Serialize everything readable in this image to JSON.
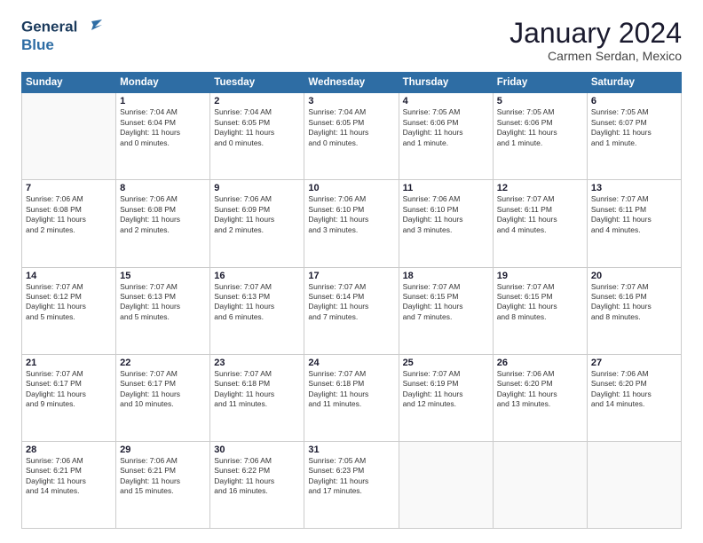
{
  "logo": {
    "line1": "General",
    "line2": "Blue"
  },
  "header": {
    "title": "January 2024",
    "subtitle": "Carmen Serdan, Mexico"
  },
  "days_of_week": [
    "Sunday",
    "Monday",
    "Tuesday",
    "Wednesday",
    "Thursday",
    "Friday",
    "Saturday"
  ],
  "weeks": [
    [
      {
        "day": "",
        "info": ""
      },
      {
        "day": "1",
        "info": "Sunrise: 7:04 AM\nSunset: 6:04 PM\nDaylight: 11 hours\nand 0 minutes."
      },
      {
        "day": "2",
        "info": "Sunrise: 7:04 AM\nSunset: 6:05 PM\nDaylight: 11 hours\nand 0 minutes."
      },
      {
        "day": "3",
        "info": "Sunrise: 7:04 AM\nSunset: 6:05 PM\nDaylight: 11 hours\nand 0 minutes."
      },
      {
        "day": "4",
        "info": "Sunrise: 7:05 AM\nSunset: 6:06 PM\nDaylight: 11 hours\nand 1 minute."
      },
      {
        "day": "5",
        "info": "Sunrise: 7:05 AM\nSunset: 6:06 PM\nDaylight: 11 hours\nand 1 minute."
      },
      {
        "day": "6",
        "info": "Sunrise: 7:05 AM\nSunset: 6:07 PM\nDaylight: 11 hours\nand 1 minute."
      }
    ],
    [
      {
        "day": "7",
        "info": "Sunrise: 7:06 AM\nSunset: 6:08 PM\nDaylight: 11 hours\nand 2 minutes."
      },
      {
        "day": "8",
        "info": "Sunrise: 7:06 AM\nSunset: 6:08 PM\nDaylight: 11 hours\nand 2 minutes."
      },
      {
        "day": "9",
        "info": "Sunrise: 7:06 AM\nSunset: 6:09 PM\nDaylight: 11 hours\nand 2 minutes."
      },
      {
        "day": "10",
        "info": "Sunrise: 7:06 AM\nSunset: 6:10 PM\nDaylight: 11 hours\nand 3 minutes."
      },
      {
        "day": "11",
        "info": "Sunrise: 7:06 AM\nSunset: 6:10 PM\nDaylight: 11 hours\nand 3 minutes."
      },
      {
        "day": "12",
        "info": "Sunrise: 7:07 AM\nSunset: 6:11 PM\nDaylight: 11 hours\nand 4 minutes."
      },
      {
        "day": "13",
        "info": "Sunrise: 7:07 AM\nSunset: 6:11 PM\nDaylight: 11 hours\nand 4 minutes."
      }
    ],
    [
      {
        "day": "14",
        "info": "Sunrise: 7:07 AM\nSunset: 6:12 PM\nDaylight: 11 hours\nand 5 minutes."
      },
      {
        "day": "15",
        "info": "Sunrise: 7:07 AM\nSunset: 6:13 PM\nDaylight: 11 hours\nand 5 minutes."
      },
      {
        "day": "16",
        "info": "Sunrise: 7:07 AM\nSunset: 6:13 PM\nDaylight: 11 hours\nand 6 minutes."
      },
      {
        "day": "17",
        "info": "Sunrise: 7:07 AM\nSunset: 6:14 PM\nDaylight: 11 hours\nand 7 minutes."
      },
      {
        "day": "18",
        "info": "Sunrise: 7:07 AM\nSunset: 6:15 PM\nDaylight: 11 hours\nand 7 minutes."
      },
      {
        "day": "19",
        "info": "Sunrise: 7:07 AM\nSunset: 6:15 PM\nDaylight: 11 hours\nand 8 minutes."
      },
      {
        "day": "20",
        "info": "Sunrise: 7:07 AM\nSunset: 6:16 PM\nDaylight: 11 hours\nand 8 minutes."
      }
    ],
    [
      {
        "day": "21",
        "info": "Sunrise: 7:07 AM\nSunset: 6:17 PM\nDaylight: 11 hours\nand 9 minutes."
      },
      {
        "day": "22",
        "info": "Sunrise: 7:07 AM\nSunset: 6:17 PM\nDaylight: 11 hours\nand 10 minutes."
      },
      {
        "day": "23",
        "info": "Sunrise: 7:07 AM\nSunset: 6:18 PM\nDaylight: 11 hours\nand 11 minutes."
      },
      {
        "day": "24",
        "info": "Sunrise: 7:07 AM\nSunset: 6:18 PM\nDaylight: 11 hours\nand 11 minutes."
      },
      {
        "day": "25",
        "info": "Sunrise: 7:07 AM\nSunset: 6:19 PM\nDaylight: 11 hours\nand 12 minutes."
      },
      {
        "day": "26",
        "info": "Sunrise: 7:06 AM\nSunset: 6:20 PM\nDaylight: 11 hours\nand 13 minutes."
      },
      {
        "day": "27",
        "info": "Sunrise: 7:06 AM\nSunset: 6:20 PM\nDaylight: 11 hours\nand 14 minutes."
      }
    ],
    [
      {
        "day": "28",
        "info": "Sunrise: 7:06 AM\nSunset: 6:21 PM\nDaylight: 11 hours\nand 14 minutes."
      },
      {
        "day": "29",
        "info": "Sunrise: 7:06 AM\nSunset: 6:21 PM\nDaylight: 11 hours\nand 15 minutes."
      },
      {
        "day": "30",
        "info": "Sunrise: 7:06 AM\nSunset: 6:22 PM\nDaylight: 11 hours\nand 16 minutes."
      },
      {
        "day": "31",
        "info": "Sunrise: 7:05 AM\nSunset: 6:23 PM\nDaylight: 11 hours\nand 17 minutes."
      },
      {
        "day": "",
        "info": ""
      },
      {
        "day": "",
        "info": ""
      },
      {
        "day": "",
        "info": ""
      }
    ]
  ]
}
